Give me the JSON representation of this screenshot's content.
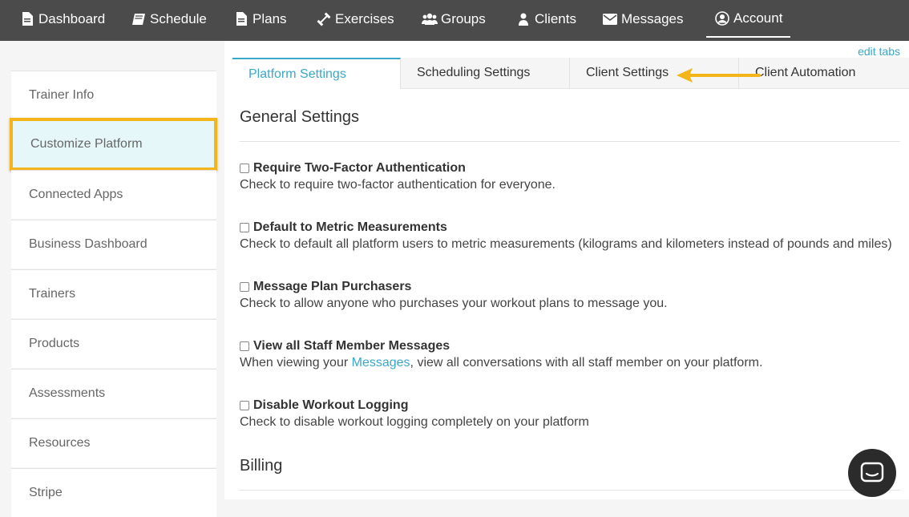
{
  "nav": {
    "items": [
      {
        "label": "Dashboard",
        "icon": "file-icon"
      },
      {
        "label": "Schedule",
        "icon": "book-icon"
      },
      {
        "label": "Plans",
        "icon": "document-icon"
      },
      {
        "label": "Exercises",
        "icon": "dumbbell-icon"
      },
      {
        "label": "Groups",
        "icon": "users-icon"
      },
      {
        "label": "Clients",
        "icon": "user-icon"
      },
      {
        "label": "Messages",
        "icon": "envelope-icon"
      },
      {
        "label": "Account",
        "icon": "user-circle-icon"
      }
    ],
    "active": "Account"
  },
  "sidebar": {
    "items": [
      {
        "label": "Trainer Info"
      },
      {
        "label": "Customize Platform"
      },
      {
        "label": "Connected Apps"
      },
      {
        "label": "Business Dashboard"
      },
      {
        "label": "Trainers"
      },
      {
        "label": "Products"
      },
      {
        "label": "Assessments"
      },
      {
        "label": "Resources"
      },
      {
        "label": "Stripe"
      }
    ],
    "active": "Customize Platform"
  },
  "edit_tabs_label": "edit tabs",
  "tabs": [
    {
      "label": "Platform Settings"
    },
    {
      "label": "Scheduling Settings"
    },
    {
      "label": "Client Settings"
    },
    {
      "label": "Client Automation"
    }
  ],
  "general": {
    "title": "General Settings",
    "settings": [
      {
        "label": "Require Two-Factor Authentication",
        "desc": "Check to require two-factor authentication for everyone.",
        "checked": false
      },
      {
        "label": "Default to Metric Measurements",
        "desc": "Check to default all platform users to metric measurements (kilograms and kilometers instead of pounds and miles)",
        "checked": false
      },
      {
        "label": "Message Plan Purchasers",
        "desc": "Check to allow anyone who purchases your workout plans to message you.",
        "checked": false
      },
      {
        "label": "View all Staff Member Messages",
        "desc_prefix": "When viewing your ",
        "desc_link": "Messages",
        "desc_suffix": ", view all conversations with all staff member on your platform.",
        "checked": false
      },
      {
        "label": "Disable Workout Logging",
        "desc": "Check to disable workout logging completely on your platform",
        "checked": false
      }
    ]
  },
  "billing": {
    "title": "Billing"
  },
  "colors": {
    "accent": "#3aa8c8",
    "highlight": "#f3b51a",
    "nav_bg": "#4b4b4b"
  }
}
